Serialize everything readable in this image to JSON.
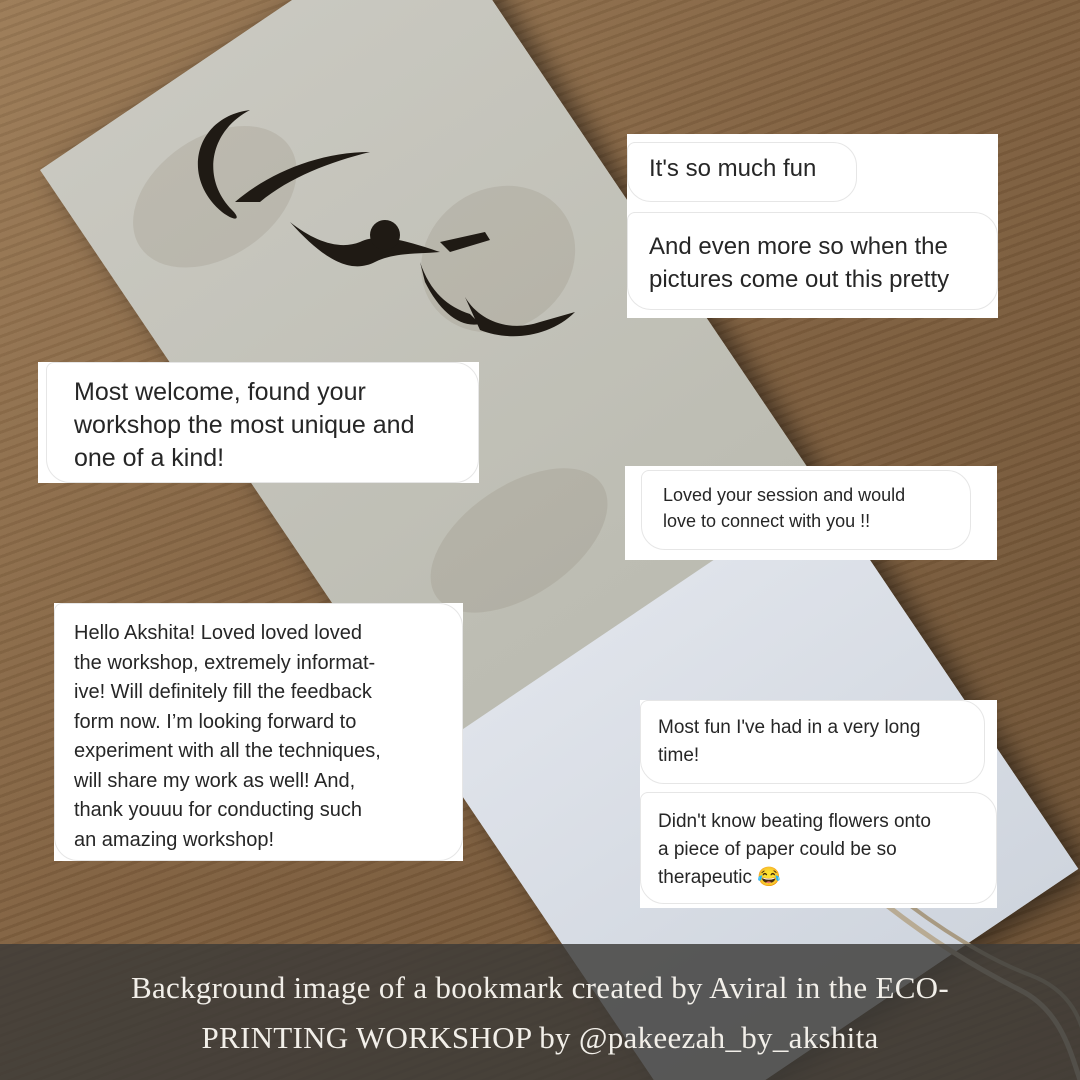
{
  "messages": {
    "fun_1": "It's so much fun",
    "fun_2": "And even more so when the\npictures come out this pretty",
    "welcome": "Most welcome, found your\nworkshop the most unique and\none of a kind!",
    "session": "Loved your session and would\nlove to connect with you !!",
    "hello": "Hello Akshita! Loved loved loved\nthe workshop, extremely informat-\nive! Will definitely fill the feedback\nform now. I’m looking forward to\nexperiment with all the techniques,\nwill share my work as well! And,\nthank youuu for conducting such\nan amazing workshop!",
    "long_time": "Most fun I've had in a very long\ntime!",
    "flowers": "Didn't know beating flowers onto\na piece of paper could be so\ntherapeutic 😂"
  },
  "caption": {
    "line_1": "Background image of a bookmark created  by  Aviral in the ECO-",
    "line_2": "PRINTING WORKSHOP by @pakeezah_by_akshita"
  },
  "colors": {
    "bubble_text": "#262626",
    "bubble_border": "#e6e6e6",
    "caption_text": "#f2efe9",
    "caption_bar": "#3c3a38"
  }
}
